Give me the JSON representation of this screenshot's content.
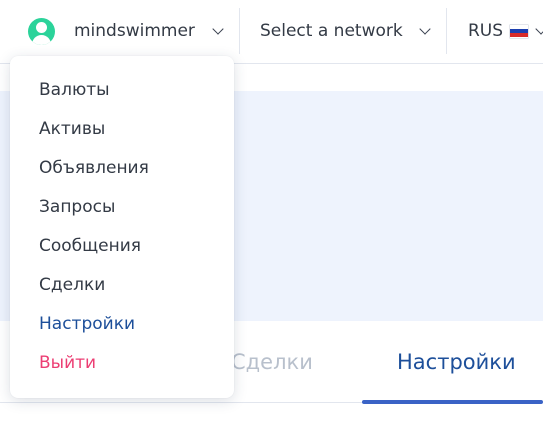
{
  "header": {
    "username": "mindswimmer",
    "network_placeholder": "Select a network",
    "language": "RUS",
    "flag_colors": [
      "#ffffff",
      "#1c3fb0",
      "#d82a2a"
    ],
    "avatar_color": "#2bd39a"
  },
  "user_menu": {
    "items": [
      {
        "label": "Валюты"
      },
      {
        "label": "Активы"
      },
      {
        "label": "Объявления"
      },
      {
        "label": "Запросы"
      },
      {
        "label": "Сообщения"
      },
      {
        "label": "Сделки"
      },
      {
        "label": "Настройки"
      },
      {
        "label": "Выйти"
      }
    ],
    "active_index": 6,
    "active_color": "#1d4f9a",
    "logout_color": "#ec3e73"
  },
  "tabs": {
    "items": [
      {
        "label": "Сделки"
      },
      {
        "label": "Настройки"
      }
    ],
    "active_index": 1,
    "accent_color": "#3a63c6"
  }
}
